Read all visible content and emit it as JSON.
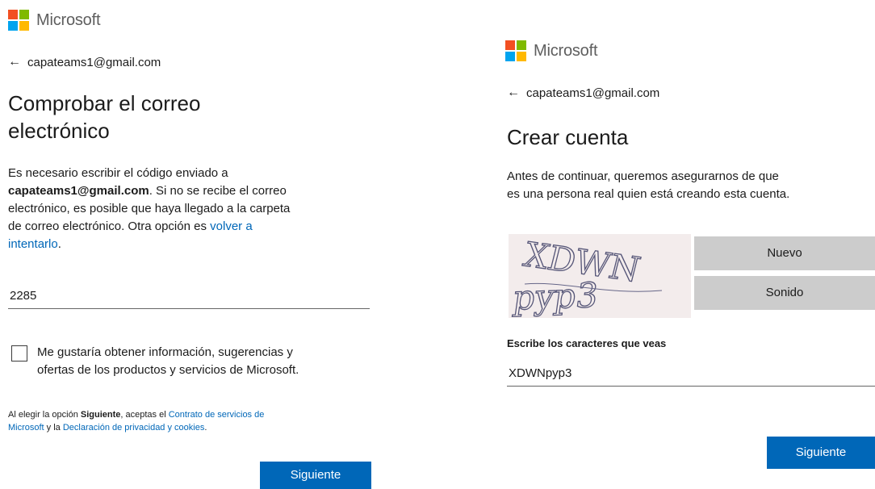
{
  "left": {
    "brand": "Microsoft",
    "email": "capateams1@gmail.com",
    "title_line1": "Comprobar el correo",
    "title_line2": "electrónico",
    "para_line1": "Es necesario escribir el código enviado a",
    "para_email": "capateams1@gmail.com",
    "para_line2_rest": ". Si no se recibe el correo",
    "para_line3": "electrónico, es posible que haya llegado a la carpeta",
    "para_line4": "de correo electrónico. Otra opción es ",
    "para_link1": "volver a",
    "para_link2": "intentarlo",
    "para_end": ".",
    "code_value": "2285",
    "checkbox_line1": "Me gustaría obtener información, sugerencias y",
    "checkbox_line2": "ofertas de los productos y servicios de Microsoft.",
    "legal_prefix": "Al elegir la opción ",
    "legal_bold": "Siguiente",
    "legal_mid": ", aceptas el ",
    "legal_link1a": "Contrato de servicios de",
    "legal_link1b": "Microsoft",
    "legal_and": " y la ",
    "legal_link2": "Declaración de privacidad y cookies",
    "legal_end": ".",
    "next_button": "Siguiente"
  },
  "right": {
    "brand": "Microsoft",
    "email": "capateams1@gmail.com",
    "title": "Crear cuenta",
    "para_line1": "Antes de continuar, queremos asegurarnos de que",
    "para_line2": "es una persona real quien está creando esta cuenta.",
    "captcha_line1": "XDWN",
    "captcha_line2": "pyp3",
    "new_button": "Nuevo",
    "audio_button": "Sonido",
    "field_label": "Escribe los caracteres que veas",
    "field_value": "XDWNpyp3",
    "next_button": "Siguiente"
  },
  "colors": {
    "accent": "#0067b8",
    "logo_red": "#f25022",
    "logo_green": "#7fba00",
    "logo_blue": "#00a4ef",
    "logo_yellow": "#ffb900"
  },
  "icons": {
    "back": "arrow-left-icon",
    "logo": "microsoft-logo-icon"
  }
}
